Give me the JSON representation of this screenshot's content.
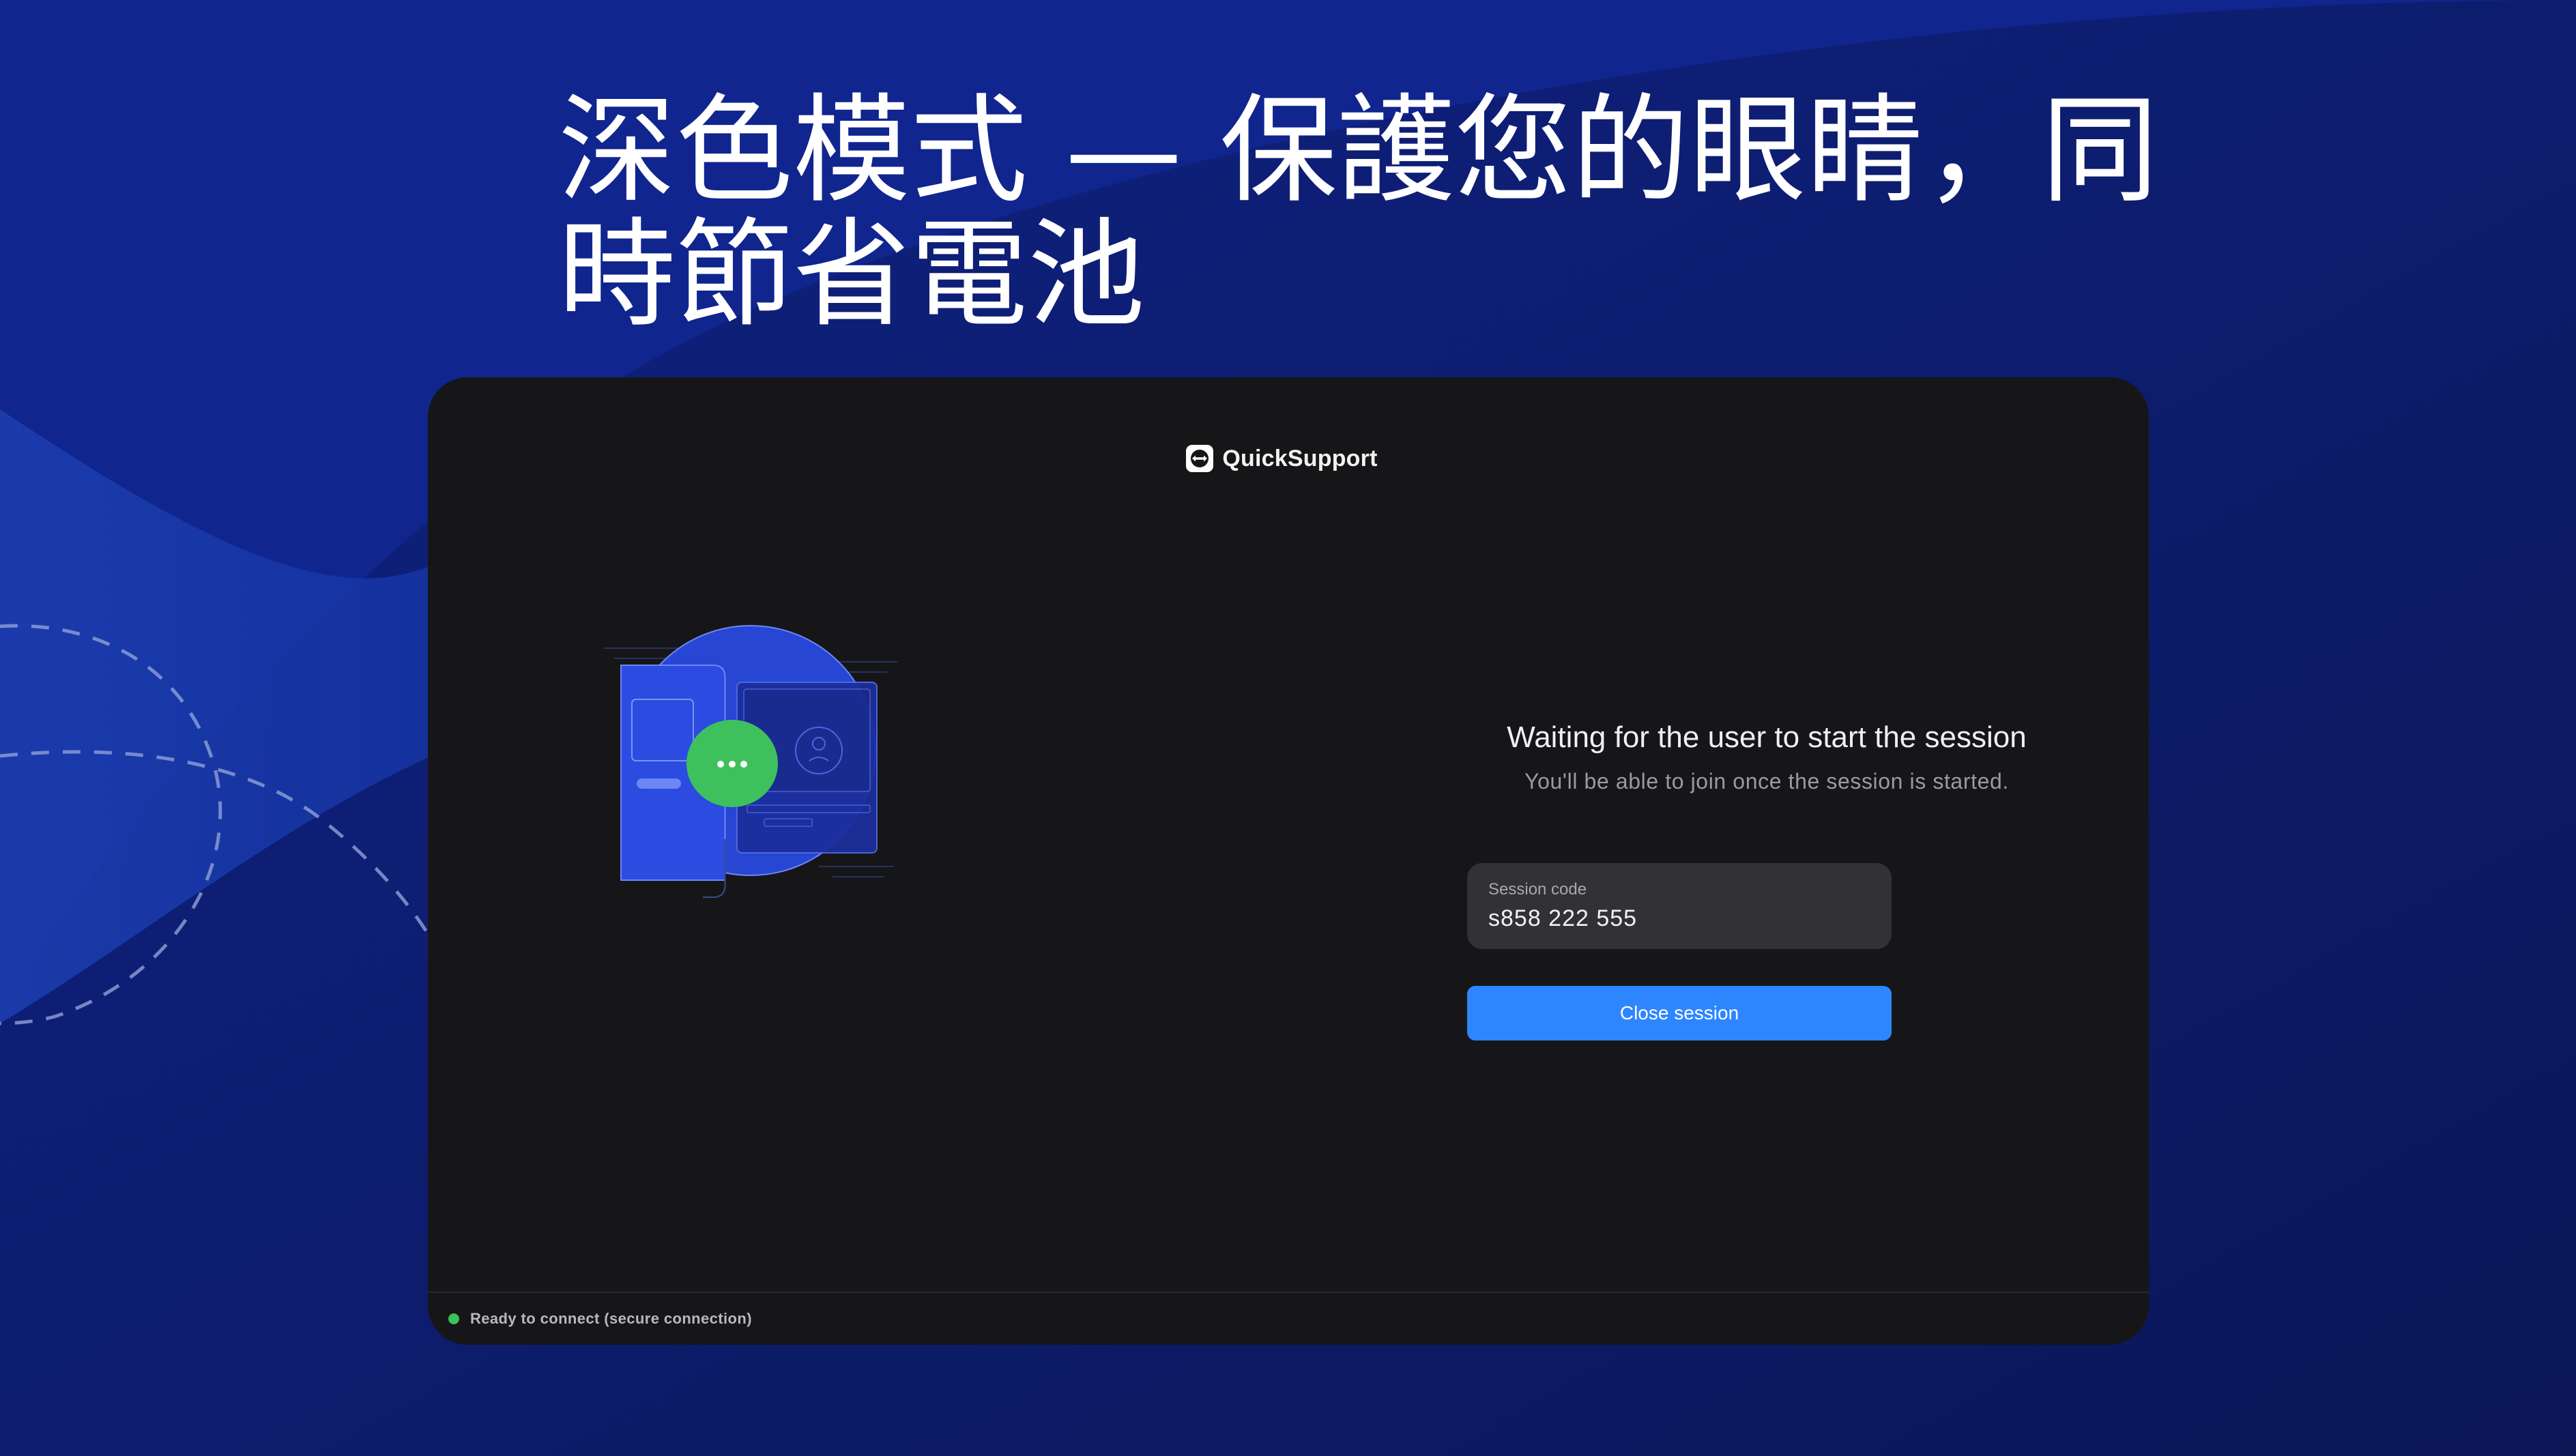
{
  "headline": {
    "line1": "深色模式 — 保護您的眼睛，同",
    "line2": "時節省電池"
  },
  "app": {
    "brand": "QuickSupport",
    "waiting_title": "Waiting for the user to start the session",
    "waiting_subtitle": "You'll be able to join once the session is started.",
    "session_code_label": "Session code",
    "session_code_value": "s858 222 555",
    "close_button": "Close session",
    "status": "Ready to connect (secure connection)"
  },
  "icons": {
    "logo": "teamviewer-logo-icon",
    "chat": "chat-bubble-icon",
    "status": "status-dot-icon"
  },
  "colors": {
    "background": "#0c1a5e",
    "window": "#161618",
    "accent": "#2e86ff",
    "success": "#3cc15a",
    "circle": "#2746d4"
  }
}
